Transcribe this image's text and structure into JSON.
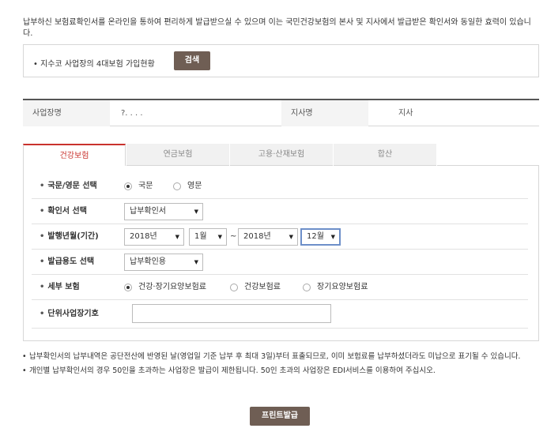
{
  "intro": "납부하신 보험료확인서를 온라인을 통하여 편리하게 발급받으실 수 있으며 이는 국민건강보험의 본사 및 지사에서 발급받은 확인서와 동일한 효력이 있습니다.",
  "search": {
    "label": "• 지수코 사업장의 4대보험 가입현황",
    "button": "검색"
  },
  "info": {
    "business_name_label": "사업장명",
    "business_name_value": "?. . . .",
    "branch_label": "지사명",
    "branch_value": "지사"
  },
  "tabs": [
    "건강보험",
    "연금보험",
    "고용·산재보험",
    "합산"
  ],
  "active_tab": 0,
  "form": {
    "language": {
      "label": "국문/영문 선택",
      "options": [
        "국문",
        "영문"
      ],
      "selected": 0
    },
    "certificate": {
      "label": "확인서 선택",
      "selected": "납부확인서"
    },
    "period": {
      "label": "발행년월(기간)",
      "from_year": "2018년",
      "from_month": "1월",
      "separator": "~",
      "to_year": "2018년",
      "to_month": "12월"
    },
    "purpose": {
      "label": "발급용도 선택",
      "selected": "납부확인용"
    },
    "detail": {
      "label": "세부 보험",
      "options": [
        "건강·장기요양보험료",
        "건강보험료",
        "장기요양보험료"
      ],
      "selected": 0
    },
    "unit_code": {
      "label": "단위사업장기호",
      "value": ""
    }
  },
  "notes": [
    "납부확인서의 납부내역은 공단전산에 반영된 날(영업일 기준 납부 후 최대 3일)부터 표출되므로, 이미 보험료를 납부하셨더라도 미납으로 표기될 수 있습니다.",
    "개인별 납부확인서의 경우 50인을 초과하는 사업장은 발급이 제한됩니다. 50인 초과의 사업장은 EDI서비스를 이용하여 주십시오."
  ],
  "print_button": "프린트발급",
  "colors": {
    "button_bg": "#6f5e54",
    "active_tab": "#c9322d",
    "focus_border": "#6d8fc9"
  }
}
